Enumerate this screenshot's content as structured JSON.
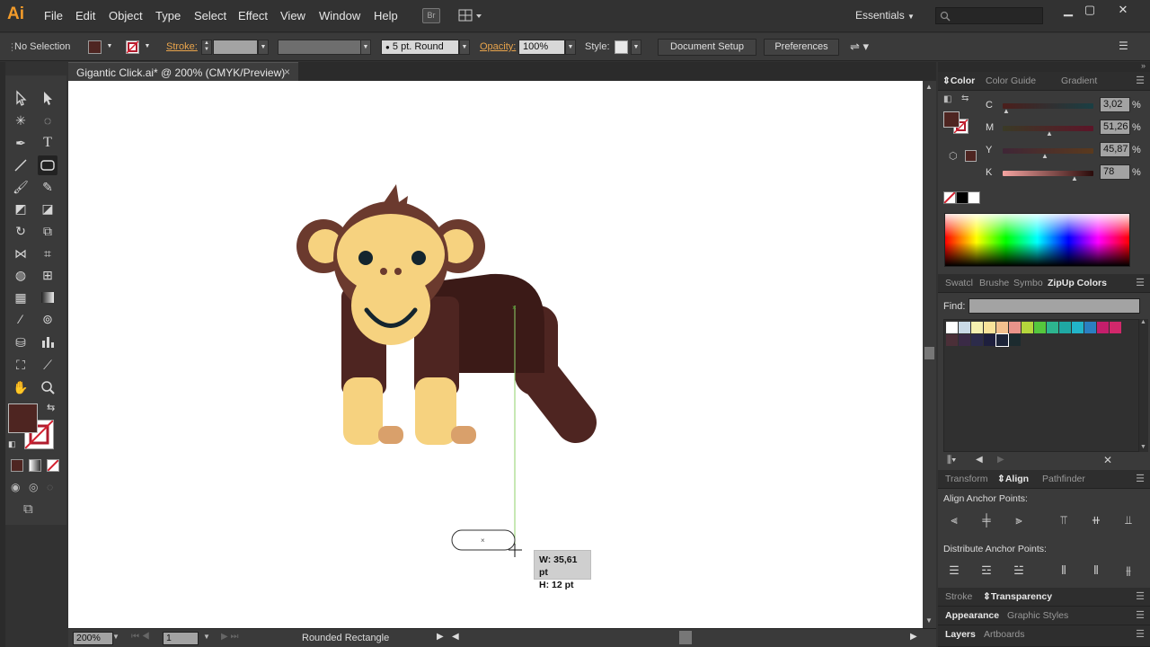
{
  "app": {
    "logo": "Ai",
    "menus": [
      "File",
      "Edit",
      "Object",
      "Type",
      "Select",
      "Effect",
      "View",
      "Window",
      "Help"
    ],
    "br_label": "Br",
    "workspace": "Essentials",
    "search_placeholder": ""
  },
  "control_bar": {
    "selection": "No Selection",
    "stroke_label": "Stroke:",
    "brush": "5 pt. Round",
    "opacity_label": "Opacity:",
    "opacity_value": "100%",
    "style_label": "Style:",
    "doc_setup": "Document Setup",
    "preferences": "Preferences"
  },
  "document": {
    "tab_title": "Gigantic Click.ai* @ 200% (CMYK/Preview)",
    "close": "×"
  },
  "canvas": {
    "tooltip_w": "W: 35,61 pt",
    "tooltip_h": "H: 12 pt"
  },
  "status": {
    "zoom": "200%",
    "artboard": "1",
    "tool": "Rounded Rectangle"
  },
  "color_panel": {
    "tabs": [
      "Color",
      "Color Guide",
      "Gradient"
    ],
    "channels": [
      {
        "label": "C",
        "value": "3,02",
        "level": 0.03
      },
      {
        "label": "M",
        "value": "51,26",
        "level": 0.51
      },
      {
        "label": "Y",
        "value": "45,87",
        "level": 0.46
      },
      {
        "label": "K",
        "value": "78",
        "level": 0.78
      }
    ],
    "percent": "%",
    "fill_color": "#4e2521"
  },
  "swatch_panel": {
    "tabs": [
      "Swatcl",
      "Brushe",
      "Symbo",
      "ZipUp Colors"
    ],
    "find_label": "Find:",
    "colors_row1": [
      "#ffffff",
      "#c9d9e6",
      "#f5f0b0",
      "#f9e39a",
      "#f2c08e",
      "#e8948a",
      "#b5d63c",
      "#55c73d",
      "#2db58f",
      "#1fa8a3",
      "#22b4c9",
      "#2a7fc1",
      "#c41e6b",
      "#d1286b"
    ],
    "colors_row2": [
      "#4b2f38",
      "#3a2a46",
      "#2c2b4a",
      "#1e1f3d",
      "#1c2438",
      "#1c2b2f"
    ]
  },
  "align_panel": {
    "tabs": [
      "Transform",
      "Align",
      "Pathfinder"
    ],
    "align_anchor_label": "Align Anchor Points:",
    "distribute_label": "Distribute Anchor Points:"
  },
  "bottom_panels": {
    "stroke": "Stroke",
    "transparency": "Transparency",
    "appearance": "Appearance",
    "graphic_styles": "Graphic Styles",
    "layers": "Layers",
    "artboards": "Artboards"
  },
  "colors": {
    "monkey_dark": "#4e2521",
    "monkey_darker": "#3b1a17",
    "monkey_mid": "#6b3a2e",
    "face": "#f6d27f",
    "foot_tan": "#d9a06b",
    "eye": "#14252e",
    "accent_orange": "#f29b2a"
  }
}
